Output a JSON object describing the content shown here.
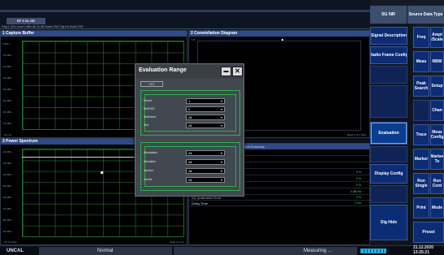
{
  "header": {
    "tab_label": "RF 5 GL NR",
    "info_line": "Freq 1 GHz Level 0 dBm Att 10 dB Frame FDD Trig Ext Mode FDD"
  },
  "windows": {
    "capture_buffer": {
      "title": "1 Capture Buffer",
      "y_labels": [
        "0 dBm",
        "-10 dBm",
        "-20 dBm",
        "-30 dBm",
        "-40 dBm",
        "-50 dBm",
        "-60 dBm",
        "-70 dBm"
      ],
      "x_left": "0.0 ms",
      "x_right": "20.0 ms"
    },
    "constellation": {
      "title": "2 Constellation Diagram",
      "subtitle": "1.5",
      "x_right": "Meas 1 of 1 Slots"
    },
    "power_spectrum": {
      "title": "3 Power Spectrum",
      "y_labels": [
        "-20 dBm",
        "-30 dBm",
        "-40 dBm",
        "-50 dBm",
        "-60 dBm",
        "-70 dBm",
        "-80 dBm",
        "-90 dBm"
      ],
      "x_left": "CF 1.0 GHz",
      "x_right": "Span 1.0 ms"
    },
    "result_summary": {
      "title": "4 Result Summary",
      "rows": [
        {
          "label": "EVM All",
          "value": ""
        },
        {
          "label": "EVM Phys Channel",
          "value": ""
        },
        {
          "label": "EVM Phys Signal",
          "value": ""
        },
        {
          "label": "Frequency Error",
          "value": "0 %"
        },
        {
          "label": "Sampling Error",
          "value": "0 %"
        },
        {
          "label": "I/Q Offset",
          "value": "0 %"
        },
        {
          "label": "I/Q Gain Imbalance",
          "value": "0 dB ms"
        },
        {
          "label": "I/Q Quadrature Error",
          "value": "0 %"
        },
        {
          "label": "Delay Time",
          "value": "0 ms"
        }
      ]
    }
  },
  "dialog": {
    "title": "Evaluation Range",
    "minimize_label": "▬",
    "close_label": "✕",
    "tab_label": "CC1",
    "group1_fields": [
      {
        "label": "Frame",
        "value": "1"
      },
      {
        "label": "BWP/SS",
        "value": "0"
      },
      {
        "label": "Subframe",
        "value": "All"
      },
      {
        "label": "Slot",
        "value": "All"
      }
    ],
    "group2_fields": [
      {
        "label": "Modulation",
        "value": "All"
      },
      {
        "label": "Allocation",
        "value": "All"
      },
      {
        "label": "Symbol",
        "value": "All"
      },
      {
        "label": "Carrier",
        "value": "All"
      }
    ]
  },
  "softkeys": {
    "headers": {
      "col1": "5G NR",
      "col2": "Source Data Type"
    },
    "col1": [
      {
        "label": "Signal Description"
      },
      {
        "label": "Radio Frame Config"
      },
      {
        "label": ""
      },
      {
        "label": ""
      },
      {
        "label": "Evaluation"
      },
      {
        "label": ""
      },
      {
        "label": "Display Config"
      },
      {
        "label": ""
      },
      {
        "label": "Dig Hide"
      }
    ],
    "col2": [
      {
        "label": "Freq"
      },
      {
        "label": "Meas"
      },
      {
        "label": "Peak Search"
      },
      {
        "label": ""
      },
      {
        "label": "Trace"
      },
      {
        "label": "Marker"
      },
      {
        "label": "Run Single"
      },
      {
        "label": "Print"
      },
      {
        "label": "Preset"
      }
    ],
    "col3": [
      {
        "label": "Ampt /Scale"
      },
      {
        "label": "RBW"
      },
      {
        "label": "Setup"
      },
      {
        "label": "Chan"
      },
      {
        "label": "Meas Config"
      },
      {
        "label": "Marker To"
      },
      {
        "label": "Run Cont"
      },
      {
        "label": "Mode"
      },
      {
        "label": ""
      }
    ]
  },
  "status": {
    "uncal": "UNCAL",
    "mode": "Normal",
    "measuring": "Measuring ...",
    "progress_percent": 100,
    "date": "21.12.2020",
    "time": "13:25:21"
  }
}
